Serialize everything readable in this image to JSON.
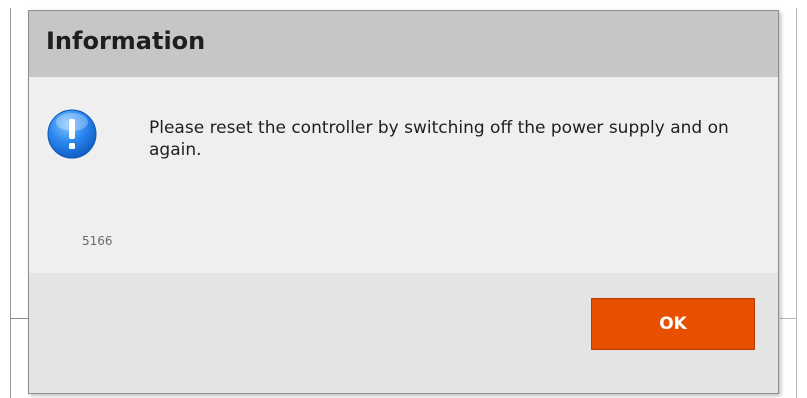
{
  "dialog": {
    "title": "Information",
    "icon": "info-exclamation-icon",
    "message": "Please reset the controller by switching off the power supply and on again.",
    "code": "5166",
    "ok_label": "OK"
  },
  "colors": {
    "title_bar": "#c6c6c6",
    "content_bg": "#efefef",
    "footer_bg": "#e4e4e4",
    "ok_button": "#e65000",
    "icon_blue": "#1f7ee8"
  }
}
